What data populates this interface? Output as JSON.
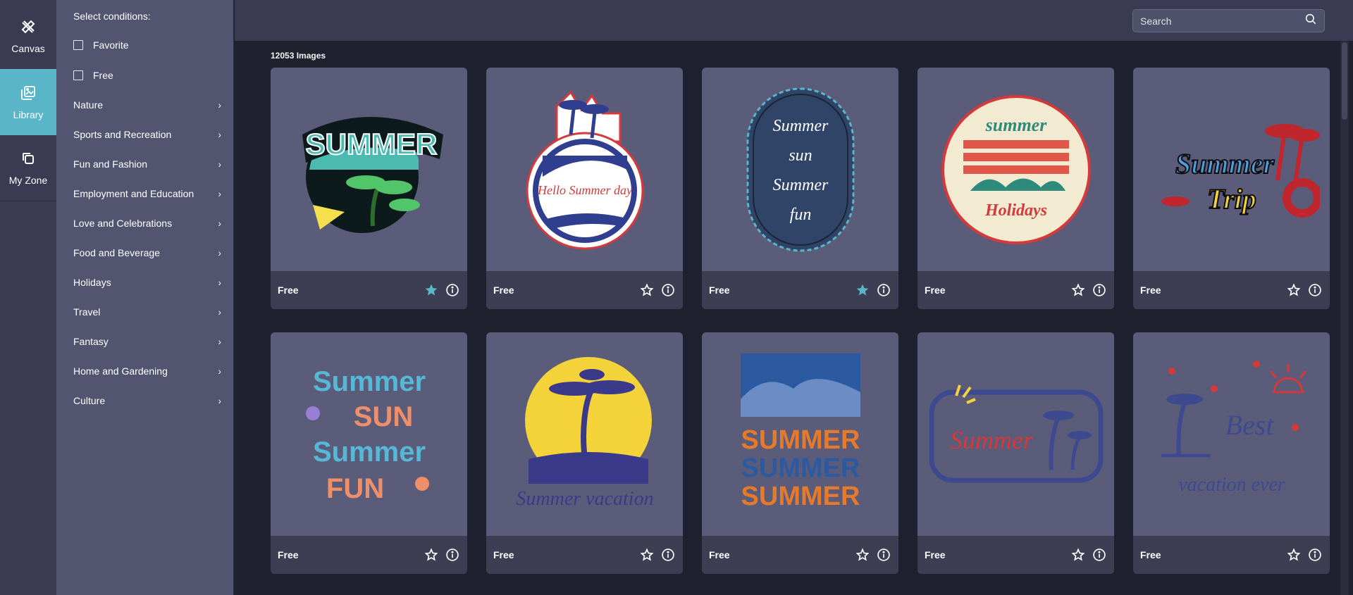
{
  "rail": {
    "canvas_label": "Canvas",
    "library_label": "Library",
    "myzone_label": "My Zone"
  },
  "filters": {
    "title": "Select conditions:",
    "checks": [
      "Favorite",
      "Free"
    ],
    "categories": [
      "Nature",
      "Sports and Recreation",
      "Fun and Fashion",
      "Employment and Education",
      "Love and Celebrations",
      "Food and Beverage",
      "Holidays",
      "Travel",
      "Fantasy",
      "Home and Gardening",
      "Culture"
    ]
  },
  "search": {
    "placeholder": "Search"
  },
  "results": {
    "count_label": "12053 Images"
  },
  "cards": [
    {
      "tag": "Free",
      "favorited": true,
      "art_text": "SUMMER"
    },
    {
      "tag": "Free",
      "favorited": false,
      "art_text": "Hello Summer day"
    },
    {
      "tag": "Free",
      "favorited": true,
      "art_text": "Summer sun Summer fun"
    },
    {
      "tag": "Free",
      "favorited": false,
      "art_text": "summer Holidays"
    },
    {
      "tag": "Free",
      "favorited": false,
      "art_text": "Summer Trip"
    },
    {
      "tag": "Free",
      "favorited": false,
      "art_text": "Summer SUN Summer FUN"
    },
    {
      "tag": "Free",
      "favorited": false,
      "art_text": "Summer vacation"
    },
    {
      "tag": "Free",
      "favorited": false,
      "art_text": "SUMMER SUMMER SUMMER"
    },
    {
      "tag": "Free",
      "favorited": false,
      "art_text": "Summer"
    },
    {
      "tag": "Free",
      "favorited": false,
      "art_text": "Best vacation ever"
    }
  ],
  "colors": {
    "accent": "#5ab5c8",
    "card_bg": "#5b5c7a",
    "card_footer": "#3d3e54",
    "panel_bg": "#53546f"
  },
  "icons": {
    "canvas": "pencil-ruler-icon",
    "library": "gallery-icon",
    "myzone": "copy-icon",
    "search": "search-icon",
    "favorite": "star-icon",
    "info": "info-icon"
  }
}
